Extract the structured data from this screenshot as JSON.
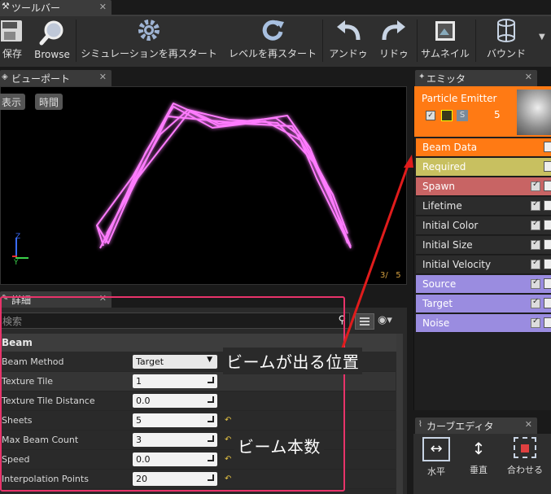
{
  "toolbar": {
    "tab_title": "ツールバー",
    "buttons": {
      "save": "保存",
      "browse": "Browse",
      "restart_sim": "シミュレーションを再スタート",
      "restart_level": "レベルを再スタート",
      "undo": "アンドゥ",
      "redo": "リドゥ",
      "thumbnail": "サムネイル",
      "bounds": "バウンド"
    }
  },
  "viewport": {
    "tab_title": "ビューポート",
    "show_btn": "表示",
    "time_btn": "時間",
    "counter": "3/   5",
    "axis_z": "Z",
    "axis_y": "Y"
  },
  "details": {
    "tab_title": "詳細",
    "search_placeholder": "検索",
    "category": "Beam",
    "rows": [
      {
        "label": "Beam Method",
        "value": "Target"
      },
      {
        "label": "Texture Tile",
        "value": "1"
      },
      {
        "label": "Texture Tile Distance",
        "value": "0.0"
      },
      {
        "label": "Sheets",
        "value": "5"
      },
      {
        "label": "Max Beam Count",
        "value": "3"
      },
      {
        "label": "Speed",
        "value": "0.0"
      },
      {
        "label": "Interpolation Points",
        "value": "20"
      }
    ]
  },
  "emitters": {
    "tab_title": "エミッタ",
    "emitter_name": "Particle Emitter",
    "emitter_count": "5",
    "emitter_s": "S",
    "modules": [
      {
        "label": "Beam Data",
        "color": "#ff7a14"
      },
      {
        "label": "Required",
        "color": "#c8c060"
      },
      {
        "label": "Spawn",
        "color": "#c86464"
      },
      {
        "label": "Lifetime",
        "color": "#2c2c2c"
      },
      {
        "label": "Initial Color",
        "color": "#2c2c2c"
      },
      {
        "label": "Initial Size",
        "color": "#2c2c2c"
      },
      {
        "label": "Initial Velocity",
        "color": "#2c2c2c"
      },
      {
        "label": "Source",
        "color": "#9a8ce0"
      },
      {
        "label": "Target",
        "color": "#9a8ce0"
      },
      {
        "label": "Noise",
        "color": "#9a8ce0"
      }
    ]
  },
  "curve_editor": {
    "tab_title": "カーブエディタ",
    "buttons": {
      "horizontal": "水平",
      "vertical": "垂直",
      "fit": "合わせる"
    }
  },
  "annotations": {
    "beam_origin": "ビームが出る位置",
    "beam_count": "ビーム本数"
  },
  "colors": {
    "accent": "#e8336a",
    "beam": "#ff7bff"
  }
}
